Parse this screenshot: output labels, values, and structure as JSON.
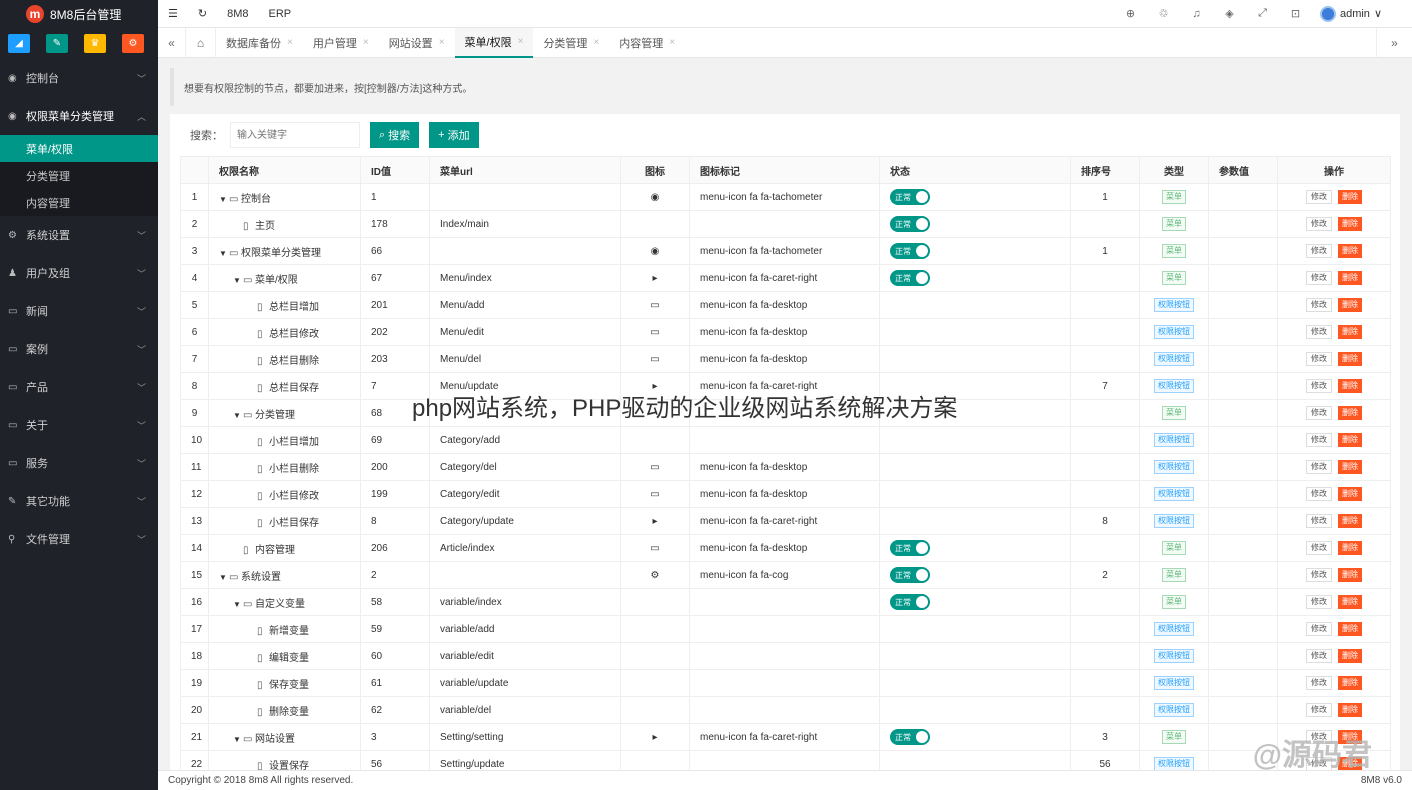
{
  "brand": {
    "logo": "m",
    "title": "8M8后台管理"
  },
  "quick_colors": [
    "#1e9fff",
    "#009688",
    "#ffb800",
    "#ff5722"
  ],
  "sidebar": {
    "groups": [
      {
        "label": "控制台",
        "icon": "tachometer-icon",
        "open": false
      },
      {
        "label": "权限菜单分类管理",
        "icon": "tachometer-icon",
        "open": true,
        "items": [
          {
            "label": "菜单/权限",
            "active": true
          },
          {
            "label": "分类管理"
          },
          {
            "label": "内容管理"
          }
        ]
      },
      {
        "label": "系统设置",
        "icon": "cog-icon"
      },
      {
        "label": "用户及组",
        "icon": "users-icon"
      },
      {
        "label": "新闻",
        "icon": "desktop-icon"
      },
      {
        "label": "案例",
        "icon": "desktop-icon"
      },
      {
        "label": "产品",
        "icon": "desktop-icon"
      },
      {
        "label": "关于",
        "icon": "desktop-icon"
      },
      {
        "label": "服务",
        "icon": "desktop-icon"
      },
      {
        "label": "其它功能",
        "icon": "wrench-icon"
      },
      {
        "label": "文件管理",
        "icon": "link-icon"
      }
    ]
  },
  "header": {
    "menu1": "8M8",
    "menu2": "ERP",
    "user": "admin"
  },
  "tabs": [
    "数据库备份",
    "用户管理",
    "网站设置",
    "菜单/权限",
    "分类管理",
    "内容管理"
  ],
  "active_tab": 3,
  "notice": "想要有权限控制的节点，都要加进来，按[控制器/方法]这种方式。",
  "search": {
    "label": "搜索：",
    "placeholder": "输入关键字",
    "search_btn": "搜索",
    "add_btn": "添加"
  },
  "table": {
    "headers": [
      "",
      "权限名称",
      "ID值",
      "菜单url",
      "图标",
      "图标标记",
      "状态",
      "排序号",
      "类型",
      "参数值",
      "操作"
    ],
    "status_label": "正常",
    "type_menu": "菜单",
    "type_btn": "权限按钮",
    "edit_label": "修改",
    "del_label": "删除",
    "rows": [
      {
        "no": "1",
        "level": 0,
        "folder": true,
        "name": "控制台",
        "id": "1",
        "url": "",
        "icon": "tachometer",
        "mark": "menu-icon fa fa-tachometer",
        "status": true,
        "sort": "1",
        "type": "menu"
      },
      {
        "no": "2",
        "level": 1,
        "folder": false,
        "name": "主页",
        "id": "178",
        "url": "Index/main",
        "icon": "",
        "mark": "",
        "status": true,
        "sort": "",
        "type": "menu"
      },
      {
        "no": "3",
        "level": 0,
        "folder": true,
        "name": "权限菜单分类管理",
        "id": "66",
        "url": "",
        "icon": "tachometer",
        "mark": "menu-icon fa fa-tachometer",
        "status": true,
        "sort": "1",
        "type": "menu"
      },
      {
        "no": "4",
        "level": 1,
        "folder": true,
        "name": "菜单/权限",
        "id": "67",
        "url": "Menu/index",
        "icon": "caret",
        "mark": "menu-icon fa fa-caret-right",
        "status": true,
        "sort": "",
        "type": "menu"
      },
      {
        "no": "5",
        "level": 2,
        "folder": false,
        "name": "总栏目增加",
        "id": "201",
        "url": "Menu/add",
        "icon": "desktop",
        "mark": "menu-icon fa fa-desktop",
        "status": false,
        "sort": "",
        "type": "btn"
      },
      {
        "no": "6",
        "level": 2,
        "folder": false,
        "name": "总栏目修改",
        "id": "202",
        "url": "Menu/edit",
        "icon": "desktop",
        "mark": "menu-icon fa fa-desktop",
        "status": false,
        "sort": "",
        "type": "btn"
      },
      {
        "no": "7",
        "level": 2,
        "folder": false,
        "name": "总栏目删除",
        "id": "203",
        "url": "Menu/del",
        "icon": "desktop",
        "mark": "menu-icon fa fa-desktop",
        "status": false,
        "sort": "",
        "type": "btn"
      },
      {
        "no": "8",
        "level": 2,
        "folder": false,
        "name": "总栏目保存",
        "id": "7",
        "url": "Menu/update",
        "icon": "caret",
        "mark": "menu-icon fa fa-caret-right",
        "status": false,
        "sort": "7",
        "type": "btn"
      },
      {
        "no": "9",
        "level": 1,
        "folder": true,
        "name": "分类管理",
        "id": "68",
        "url": "",
        "icon": "",
        "mark": "",
        "status": false,
        "sort": "",
        "type": "menu"
      },
      {
        "no": "10",
        "level": 2,
        "folder": false,
        "name": "小栏目增加",
        "id": "69",
        "url": "Category/add",
        "icon": "",
        "mark": "",
        "status": false,
        "sort": "",
        "type": "btn"
      },
      {
        "no": "11",
        "level": 2,
        "folder": false,
        "name": "小栏目删除",
        "id": "200",
        "url": "Category/del",
        "icon": "desktop",
        "mark": "menu-icon fa fa-desktop",
        "status": false,
        "sort": "",
        "type": "btn"
      },
      {
        "no": "12",
        "level": 2,
        "folder": false,
        "name": "小栏目修改",
        "id": "199",
        "url": "Category/edit",
        "icon": "desktop",
        "mark": "menu-icon fa fa-desktop",
        "status": false,
        "sort": "",
        "type": "btn"
      },
      {
        "no": "13",
        "level": 2,
        "folder": false,
        "name": "小栏目保存",
        "id": "8",
        "url": "Category/update",
        "icon": "caret",
        "mark": "menu-icon fa fa-caret-right",
        "status": false,
        "sort": "8",
        "type": "btn"
      },
      {
        "no": "14",
        "level": 1,
        "folder": false,
        "name": "内容管理",
        "id": "206",
        "url": "Article/index",
        "icon": "desktop",
        "mark": "menu-icon fa fa-desktop",
        "status": true,
        "sort": "",
        "type": "menu"
      },
      {
        "no": "15",
        "level": 0,
        "folder": true,
        "name": "系统设置",
        "id": "2",
        "url": "",
        "icon": "cog",
        "mark": "menu-icon fa fa-cog",
        "status": true,
        "sort": "2",
        "type": "menu"
      },
      {
        "no": "16",
        "level": 1,
        "folder": true,
        "name": "自定义变量",
        "id": "58",
        "url": "variable/index",
        "icon": "",
        "mark": "",
        "status": true,
        "sort": "",
        "type": "menu"
      },
      {
        "no": "17",
        "level": 2,
        "folder": false,
        "name": "新增变量",
        "id": "59",
        "url": "variable/add",
        "icon": "",
        "mark": "",
        "status": false,
        "sort": "",
        "type": "btn"
      },
      {
        "no": "18",
        "level": 2,
        "folder": false,
        "name": "编辑变量",
        "id": "60",
        "url": "variable/edit",
        "icon": "",
        "mark": "",
        "status": false,
        "sort": "",
        "type": "btn"
      },
      {
        "no": "19",
        "level": 2,
        "folder": false,
        "name": "保存变量",
        "id": "61",
        "url": "variable/update",
        "icon": "",
        "mark": "",
        "status": false,
        "sort": "",
        "type": "btn"
      },
      {
        "no": "20",
        "level": 2,
        "folder": false,
        "name": "删除变量",
        "id": "62",
        "url": "variable/del",
        "icon": "",
        "mark": "",
        "status": false,
        "sort": "",
        "type": "btn"
      },
      {
        "no": "21",
        "level": 1,
        "folder": true,
        "name": "网站设置",
        "id": "3",
        "url": "Setting/setting",
        "icon": "caret",
        "mark": "menu-icon fa fa-caret-right",
        "status": true,
        "sort": "3",
        "type": "menu"
      },
      {
        "no": "22",
        "level": 2,
        "folder": false,
        "name": "设置保存",
        "id": "56",
        "url": "Setting/update",
        "icon": "",
        "mark": "",
        "status": false,
        "sort": "56",
        "type": "btn"
      }
    ]
  },
  "overlay_text": "php网站系统，PHP驱动的企业级网站系统解决方案",
  "watermark": "@源码君",
  "footer": {
    "copyright": "Copyright © 2018 8m8 All rights reserved.",
    "version": "8M8 v6.0"
  }
}
